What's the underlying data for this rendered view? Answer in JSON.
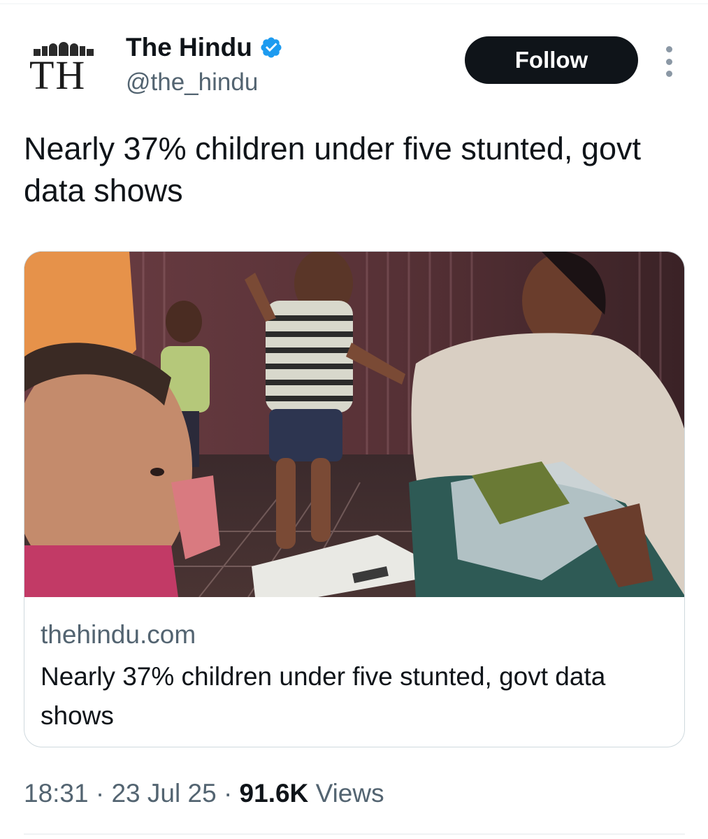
{
  "account": {
    "display_name": "The Hindu",
    "handle": "@the_hindu",
    "avatar_monogram": "TH",
    "verified_icon": "verified-badge-icon"
  },
  "actions": {
    "follow_label": "Follow",
    "more_icon": "more-vertical-icon"
  },
  "tweet": {
    "text": "Nearly 37% children under five stunted, govt data shows"
  },
  "link_card": {
    "image_icon": "photo-child-weighing",
    "domain": "thehindu.com",
    "title": "Nearly 37% children under five stunted, govt data shows"
  },
  "meta": {
    "time": "18:31",
    "separator": "·",
    "date": "23 Jul 25",
    "views_count": "91.6K",
    "views_label": "Views"
  },
  "colors": {
    "text_primary": "#0f1419",
    "text_secondary": "#536471",
    "verified_blue": "#1d9bf0",
    "follow_bg": "#0f1419",
    "border": "#cfd9de"
  }
}
